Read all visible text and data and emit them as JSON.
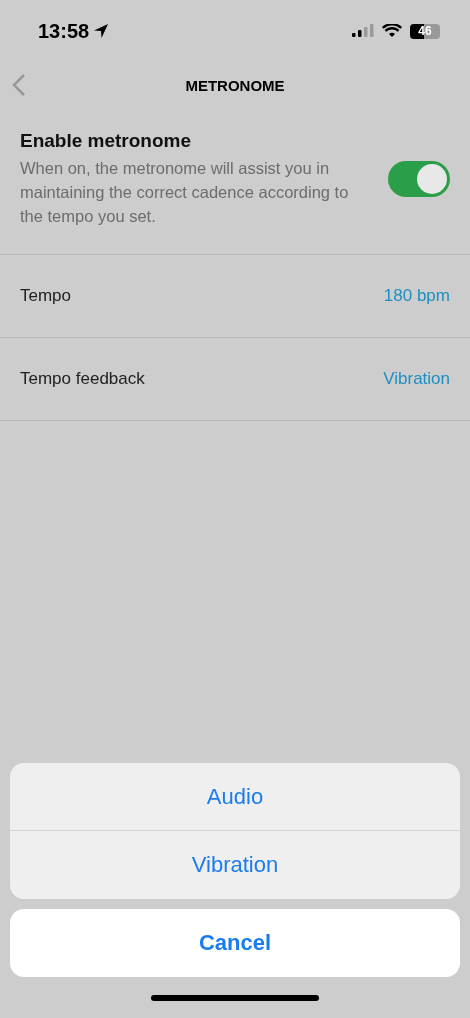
{
  "status_bar": {
    "time": "13:58",
    "battery": "46"
  },
  "nav": {
    "title": "METRONOME"
  },
  "enable": {
    "title": "Enable metronome",
    "description": "When on, the metronome will assist you in maintaining the correct cadence according to the tempo you set.",
    "on": true
  },
  "settings": [
    {
      "label": "Tempo",
      "value": "180 bpm"
    },
    {
      "label": "Tempo feedback",
      "value": "Vibration"
    }
  ],
  "action_sheet": {
    "options": [
      "Audio",
      "Vibration"
    ],
    "cancel": "Cancel"
  }
}
